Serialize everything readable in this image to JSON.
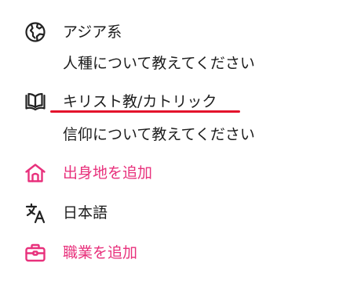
{
  "profile_details": {
    "ethnicity": {
      "value": "アジア系",
      "prompt": "人種について教えてください",
      "icon": "globe-icon"
    },
    "religion": {
      "value": "キリスト教/カトリック",
      "prompt": "信仰について教えてください",
      "icon": "book-icon",
      "annotation_color": "#e3102b"
    },
    "hometown": {
      "label": "出身地を追加",
      "icon": "home-icon",
      "color": "#e8317c"
    },
    "language": {
      "value": "日本語",
      "icon": "translate-icon"
    },
    "job": {
      "label": "職業を追加",
      "icon": "briefcase-icon",
      "color": "#e8317c"
    }
  }
}
